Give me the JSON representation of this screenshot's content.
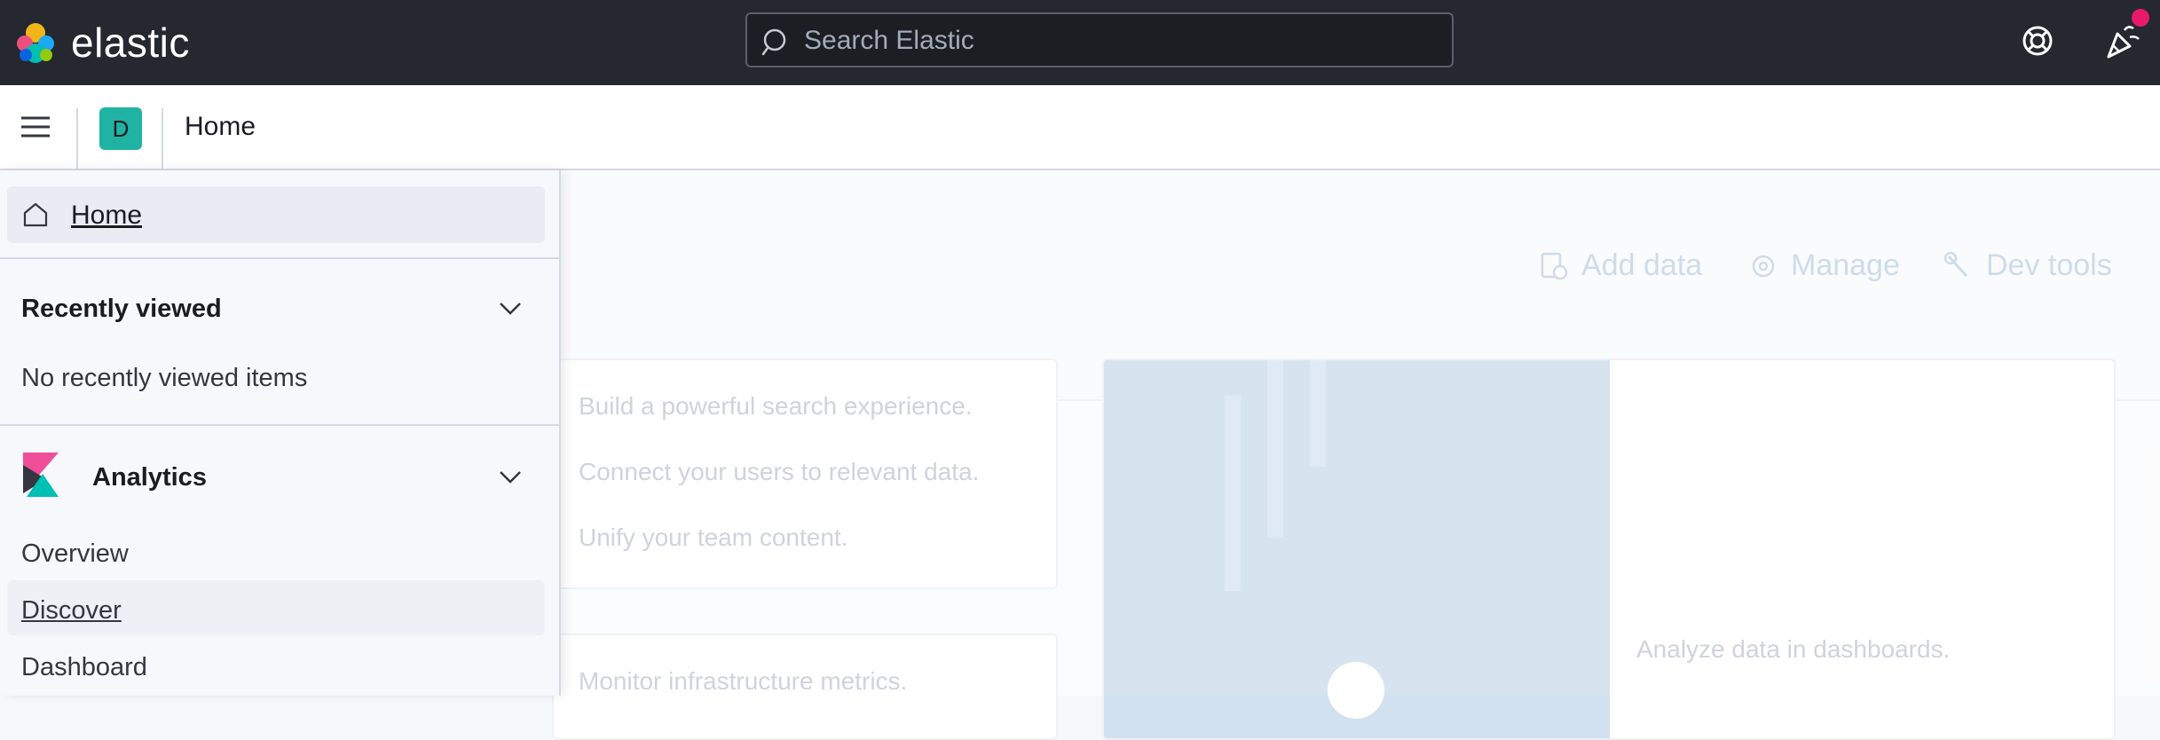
{
  "header": {
    "logo_text": "elastic",
    "search_placeholder": "Search Elastic",
    "help_icon": "help-icon",
    "news_icon": "newsfeed-icon",
    "news_badge_color": "#e7196a"
  },
  "subheader": {
    "space_initial": "D",
    "space_color": "#20b3a4",
    "breadcrumb": "Home"
  },
  "nav": {
    "home_label": "Home",
    "recently_viewed": {
      "title": "Recently viewed",
      "empty_text": "No recently viewed items"
    },
    "analytics": {
      "title": "Analytics",
      "items": [
        {
          "label": "Overview"
        },
        {
          "label": "Discover"
        },
        {
          "label": "Dashboard"
        }
      ]
    }
  },
  "page": {
    "actions": [
      {
        "label": "Add data",
        "icon": "add-data-icon"
      },
      {
        "label": "Manage",
        "icon": "gear-icon"
      },
      {
        "label": "Dev tools",
        "icon": "wrench-icon"
      }
    ],
    "search_card_lines": [
      "Build a powerful search experience.",
      "Connect your users to relevant data.",
      "Unify your team content."
    ],
    "observability_card_line": "Monitor infrastructure metrics.",
    "analytics_card_text": "Analyze data in dashboards."
  }
}
